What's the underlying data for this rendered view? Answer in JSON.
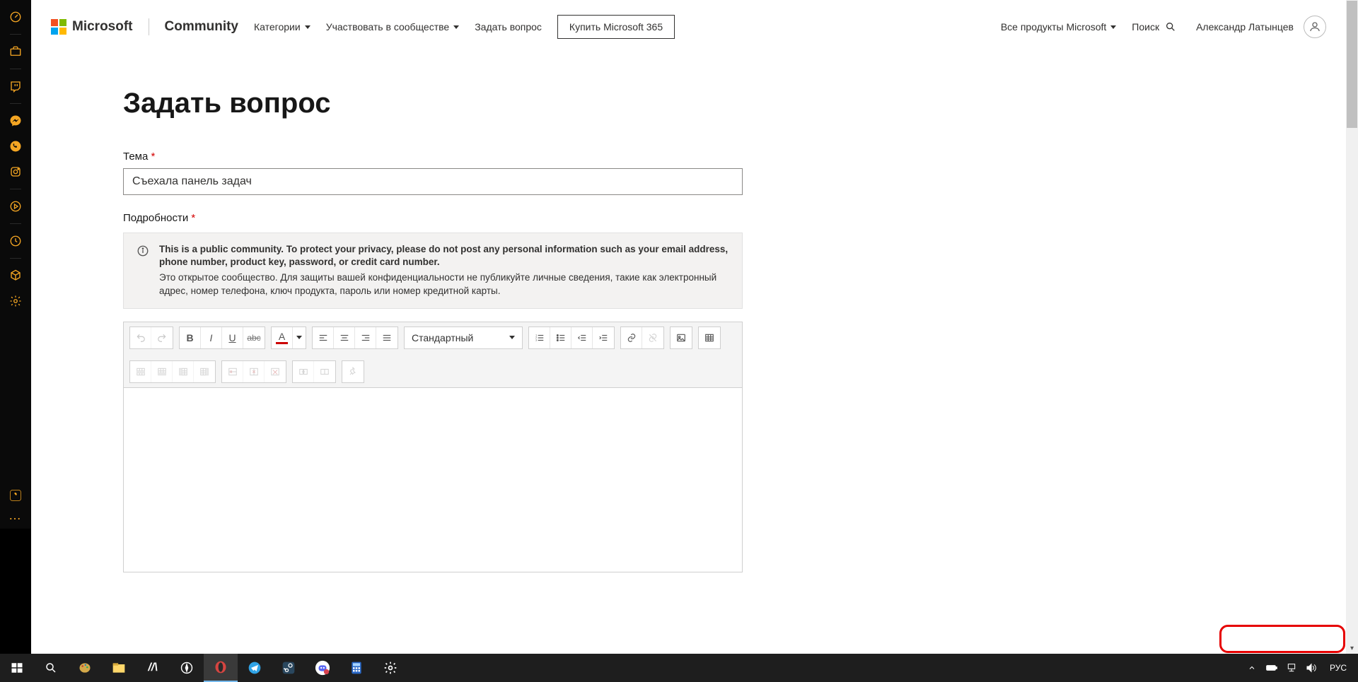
{
  "header": {
    "brand": "Microsoft",
    "community": "Community",
    "nav_categories": "Категории",
    "nav_participate": "Участвовать в сообществе",
    "nav_ask": "Задать вопрос",
    "buy_m365": "Купить Microsoft 365",
    "all_products": "Все продукты Microsoft",
    "search": "Поиск",
    "user_name": "Александр Латынцев"
  },
  "page": {
    "title": "Задать вопрос",
    "subject_label": "Тема",
    "subject_value": "Съехала панель задач",
    "details_label": "Подробности",
    "notice_en": "This is a public community. To protect your privacy, please do not post any personal information such as your email address, phone number, product key, password, or credit card number.",
    "notice_ru": "Это открытое сообщество. Для защиты вашей конфиденциальности не публикуйте личные сведения, такие как электронный адрес, номер телефона, ключ продукта, пароль или номер кредитной карты."
  },
  "editor": {
    "format_label": "Стандартный"
  },
  "taskbar": {
    "lang": "РУС"
  }
}
